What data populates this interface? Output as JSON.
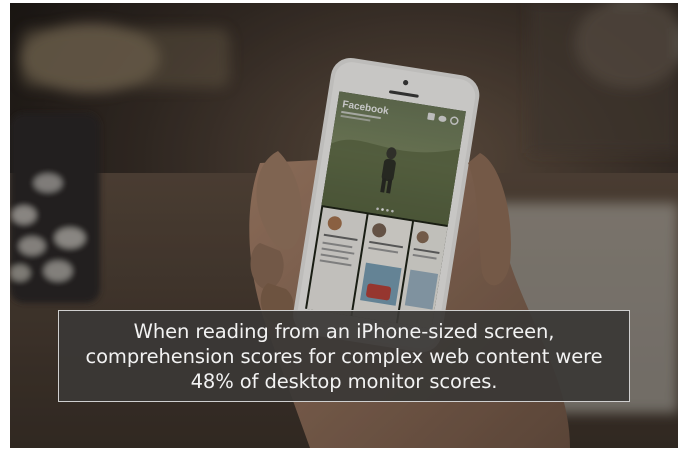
{
  "phone": {
    "app_title": "Facebook"
  },
  "caption": {
    "text": "When reading from an iPhone-sized screen, comprehension scores for complex web content were 48% of desktop monitor scores."
  },
  "colors": {
    "caption_background": "#3a3836",
    "caption_border": "#cfcfcf",
    "caption_text": "#f2f2f2"
  },
  "icons": [
    "phone-app-icon",
    "chat-icon",
    "settings-icon"
  ]
}
